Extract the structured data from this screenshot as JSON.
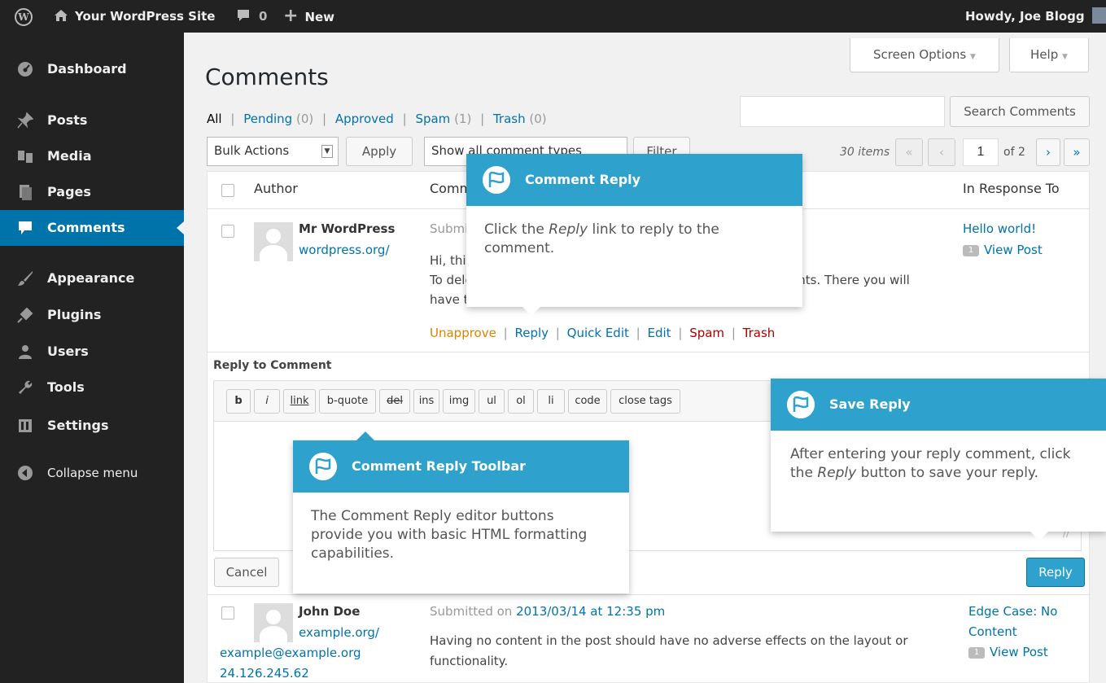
{
  "adminbar": {
    "wp_logo": "W",
    "site_name": "Your WordPress Site",
    "comments_count": "0",
    "new_label": "New",
    "howdy": "Howdy, Joe Blogg"
  },
  "sidebar": {
    "items": [
      {
        "label": "Dashboard",
        "icon": "dashboard-icon"
      },
      {
        "label": "Posts",
        "icon": "pin-icon"
      },
      {
        "label": "Media",
        "icon": "media-icon"
      },
      {
        "label": "Pages",
        "icon": "pages-icon"
      },
      {
        "label": "Comments",
        "icon": "comment-icon"
      },
      {
        "label": "Appearance",
        "icon": "brush-icon"
      },
      {
        "label": "Plugins",
        "icon": "plug-icon"
      },
      {
        "label": "Users",
        "icon": "users-icon"
      },
      {
        "label": "Tools",
        "icon": "wrench-icon"
      },
      {
        "label": "Settings",
        "icon": "settings-icon"
      }
    ],
    "collapse_label": "Collapse menu"
  },
  "header": {
    "title": "Comments",
    "screen_options": "Screen Options",
    "help": "Help",
    "dropdown_glyph": "▼"
  },
  "filters": {
    "all": "All",
    "sep": "|",
    "pending": "Pending",
    "pending_count": "(0)",
    "approved": "Approved",
    "spam": "Spam",
    "spam_count": "(1)",
    "trash": "Trash",
    "trash_count": "(0)"
  },
  "search": {
    "button": "Search Comments",
    "value": ""
  },
  "toolbar": {
    "bulk_actions": "Bulk Actions",
    "apply": "Apply",
    "comment_types": "Show all comment types",
    "filter": "Filter",
    "items_count": "30 items",
    "first_page": "«",
    "prev_page": "‹",
    "current_page": "1",
    "of_pages": "of 2",
    "next_page": "›",
    "last_page": "»"
  },
  "table": {
    "col_author": "Author",
    "col_comment": "Comment",
    "col_response": "In Response To"
  },
  "comment1": {
    "author": "Mr WordPress",
    "url": "wordpress.org/",
    "submitted_prefix": "Submitted on",
    "line1": "Hi, this is a comment.",
    "line2": "To delete a comment, just log in and view the post's comments. There you will",
    "line3": "have the option to edit or delete them.",
    "actions": {
      "unapprove": "Unapprove",
      "reply": "Reply",
      "quick_edit": "Quick Edit",
      "edit": "Edit",
      "spam": "Spam",
      "trash": "Trash",
      "sep": "|"
    },
    "response_post": "Hello world!",
    "response_count": "1",
    "view_post": "View Post"
  },
  "reply_box": {
    "title": "Reply to Comment",
    "quicktags": [
      "b",
      "i",
      "link",
      "b-quote",
      "del",
      "ins",
      "img",
      "ul",
      "ol",
      "li",
      "code",
      "close tags"
    ],
    "textarea_value": "",
    "cancel": "Cancel",
    "reply": "Reply"
  },
  "comment2": {
    "author": "John Doe",
    "url": "example.org/",
    "email": "example@example.org",
    "ip": "24.126.245.62",
    "submitted_prefix": "Submitted on",
    "submitted_date": "2013/03/14 at 12:35 pm",
    "line1": "Having no content in the post should have no adverse effects on the layout or",
    "line2": "functionality.",
    "response_post_1": "Edge Case: No",
    "response_post_2": "Content",
    "response_count": "1",
    "view_post": "View Post"
  },
  "pointers": {
    "comment_reply": {
      "title": "Comment Reply",
      "body_1": "Click the ",
      "body_em": "Reply",
      "body_2": " link to reply to the comment."
    },
    "save_reply": {
      "title": "Save Reply",
      "body_1": "After entering your reply comment, click the ",
      "body_em": "Reply",
      "body_2": " button to save your reply."
    },
    "toolbar": {
      "title": "Comment Reply Toolbar",
      "body": "The Comment Reply editor buttons provide you with basic HTML formatting capabilities."
    }
  },
  "colors": {
    "accent": "#0073aa",
    "pointer_header": "#2ea2cc",
    "unapprove": "#d98500",
    "danger": "#a00",
    "admin_bg": "#222222"
  }
}
